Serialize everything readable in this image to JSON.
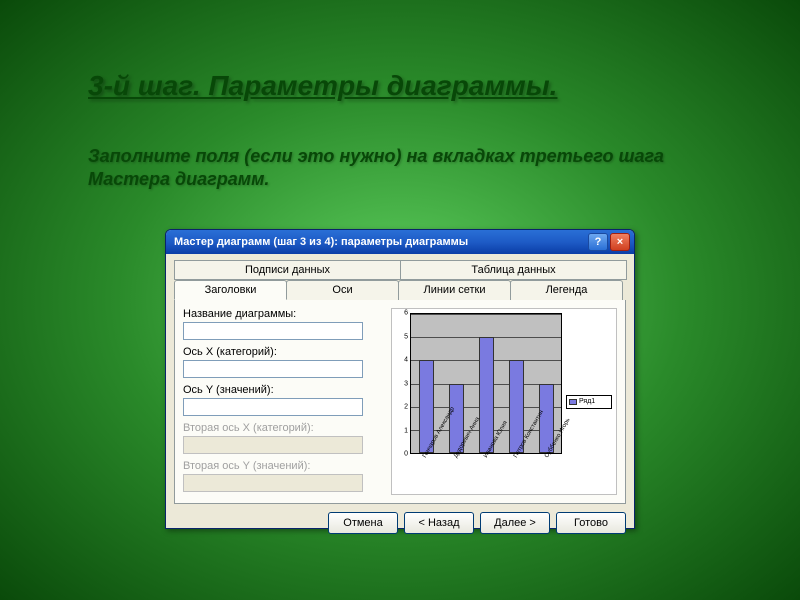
{
  "slide": {
    "title": "3-й шаг. Параметры диаграммы.",
    "subtitle": "Заполните поля (если это нужно) на вкладках третьего шага Мастера диаграмм."
  },
  "dialog": {
    "title": "Мастер диаграмм (шаг 3 из 4): параметры диаграммы",
    "help": "?",
    "close": "×",
    "tabs_top": [
      "Подписи данных",
      "Таблица данных"
    ],
    "tabs_bottom": [
      "Заголовки",
      "Оси",
      "Линии сетки",
      "Легенда"
    ],
    "active_tab": "Заголовки",
    "fields": [
      {
        "key": "title",
        "label": "Название диаграммы:",
        "disabled": false
      },
      {
        "key": "x",
        "label": "Ось X (категорий):",
        "disabled": false
      },
      {
        "key": "y",
        "label": "Ось Y (значений):",
        "disabled": false
      },
      {
        "key": "x2",
        "label": "Вторая ось X (категорий):",
        "disabled": true
      },
      {
        "key": "y2",
        "label": "Вторая ось Y (значений):",
        "disabled": true
      }
    ],
    "buttons": {
      "cancel": "Отмена",
      "back": "< Назад",
      "next": "Далее >",
      "finish": "Готово"
    }
  },
  "chart_data": {
    "type": "bar",
    "categories": [
      "Гончаров Александр",
      "Дудоревич Анна",
      "Иванова Юлия",
      "Петров Константин",
      "Суббенко Игорь"
    ],
    "values": [
      4,
      3,
      5,
      4,
      3
    ],
    "ylim": [
      0,
      6
    ],
    "yticks": [
      0,
      1,
      2,
      3,
      4,
      5,
      6
    ],
    "legend": "Ряд1"
  }
}
